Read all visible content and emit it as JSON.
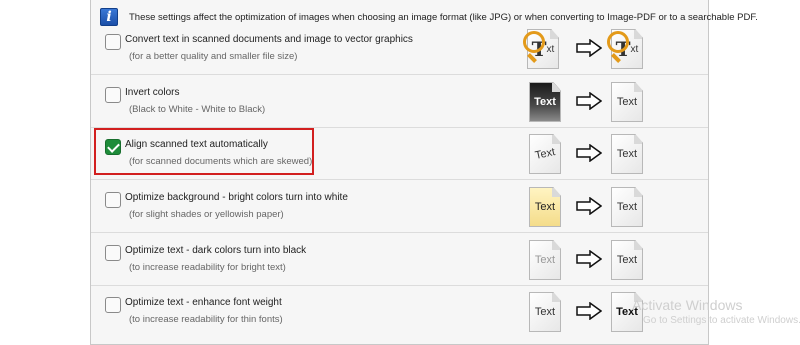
{
  "info": {
    "icon": "info-icon",
    "text": "These settings affect the optimization of images when choosing an image format (like JPG) or when converting to Image-PDF or to a searchable PDF."
  },
  "options": [
    {
      "label": "Convert text in scanned documents and image to vector graphics",
      "sub": "(for a better quality and smaller file size)",
      "checked": false,
      "before": "T",
      "after": "T"
    },
    {
      "label": "Invert colors",
      "sub": "(Black to White - White to Black)",
      "checked": false,
      "before": "Text",
      "after": "Text"
    },
    {
      "label": "Align scanned text automatically",
      "sub": "(for scanned documents which are skewed)",
      "checked": true,
      "before": "Text",
      "after": "Text"
    },
    {
      "label": "Optimize background - bright colors turn into white",
      "sub": "(for slight shades or yellowish paper)",
      "checked": false,
      "before": "Text",
      "after": "Text"
    },
    {
      "label": "Optimize text - dark colors turn into black",
      "sub": "(to increase readability for bright text)",
      "checked": false,
      "before": "Text",
      "after": "Text"
    },
    {
      "label": "Optimize text - enhance font weight",
      "sub": "(to increase readability for thin fonts)",
      "checked": false,
      "before": "Text",
      "after": "Text"
    }
  ],
  "doc_suffix": "xt",
  "watermark": {
    "title": "Activate Windows",
    "subtitle": "Go to Settings to activate Windows."
  },
  "colors": {
    "checked": "#1e8c3a",
    "highlight": "#d21f1f",
    "info": "#1b4fa8"
  }
}
